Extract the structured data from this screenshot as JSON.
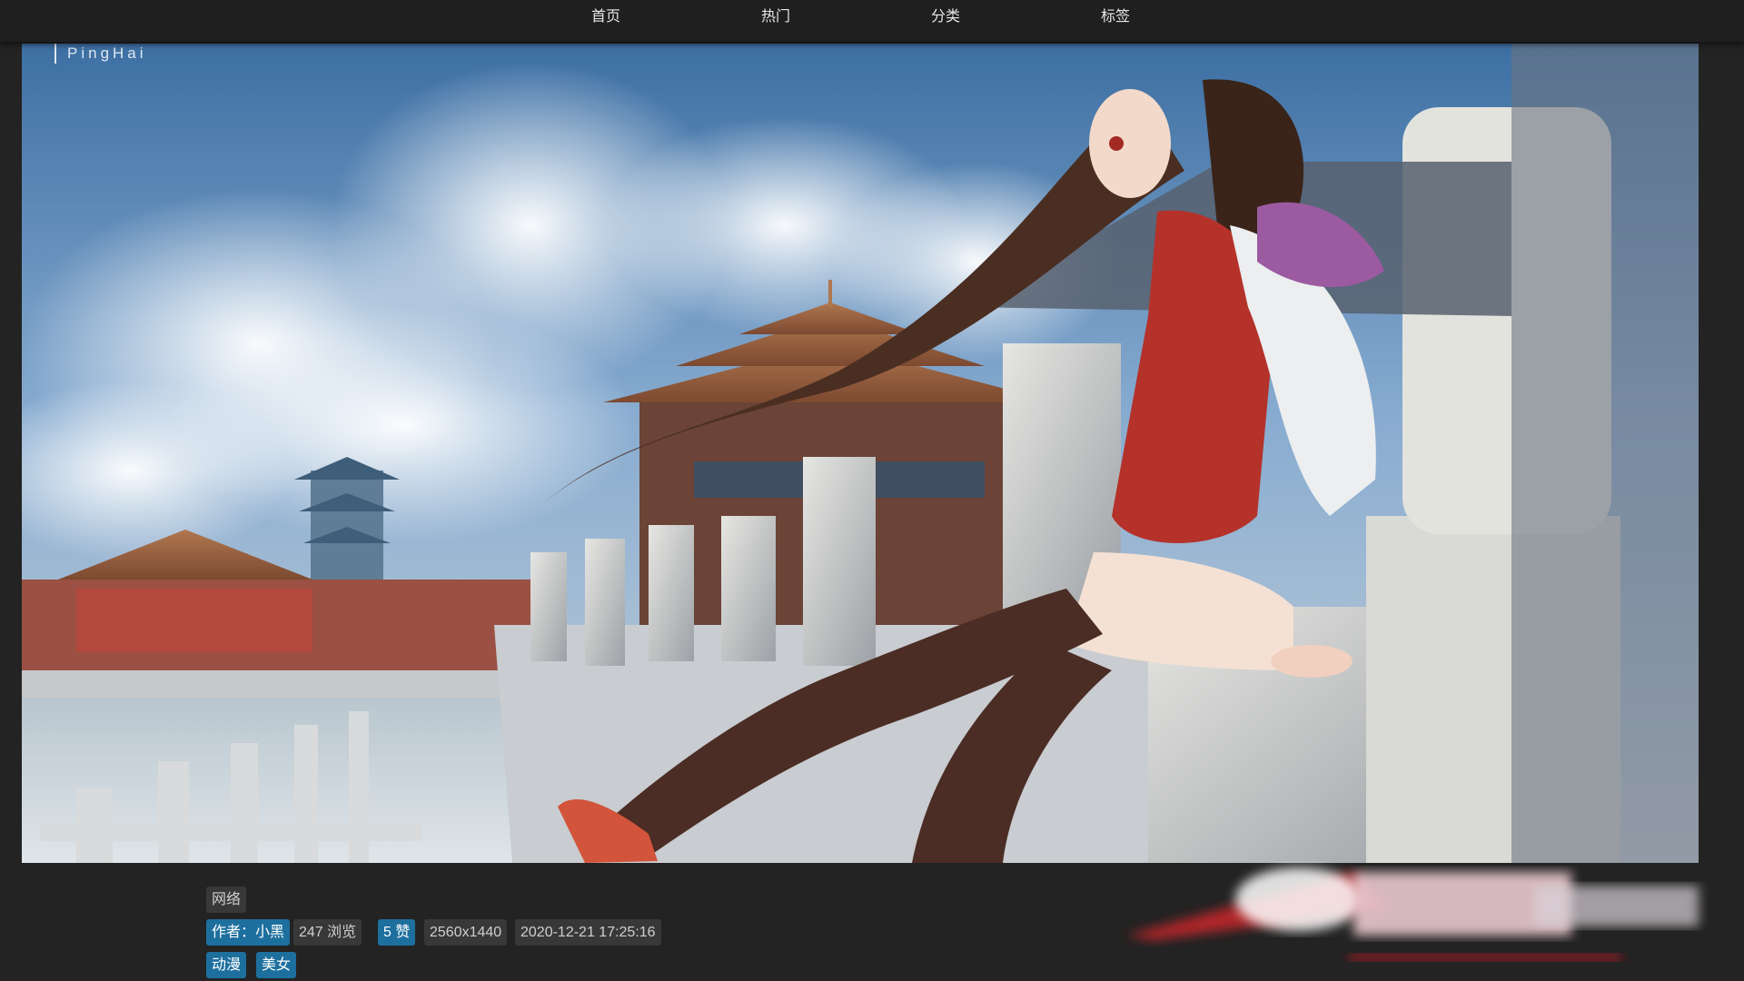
{
  "nav": {
    "home": "首页",
    "hot": "热门",
    "category": "分类",
    "tags": "标签"
  },
  "image": {
    "watermark": "PingHai",
    "description_icon": "anime-wallpaper-image"
  },
  "info": {
    "source": "网络",
    "author": "作者：小黑",
    "views": "247 浏览",
    "likes": "5 赞",
    "resolution": "2560x1440",
    "date": "2020-12-21 17:25:16",
    "tags": [
      "动漫",
      "美女"
    ]
  },
  "colors": {
    "background": "#232323",
    "nav_background": "#1f1f1f",
    "chip_gray": "#383838",
    "chip_blue": "#1d6f9e"
  }
}
